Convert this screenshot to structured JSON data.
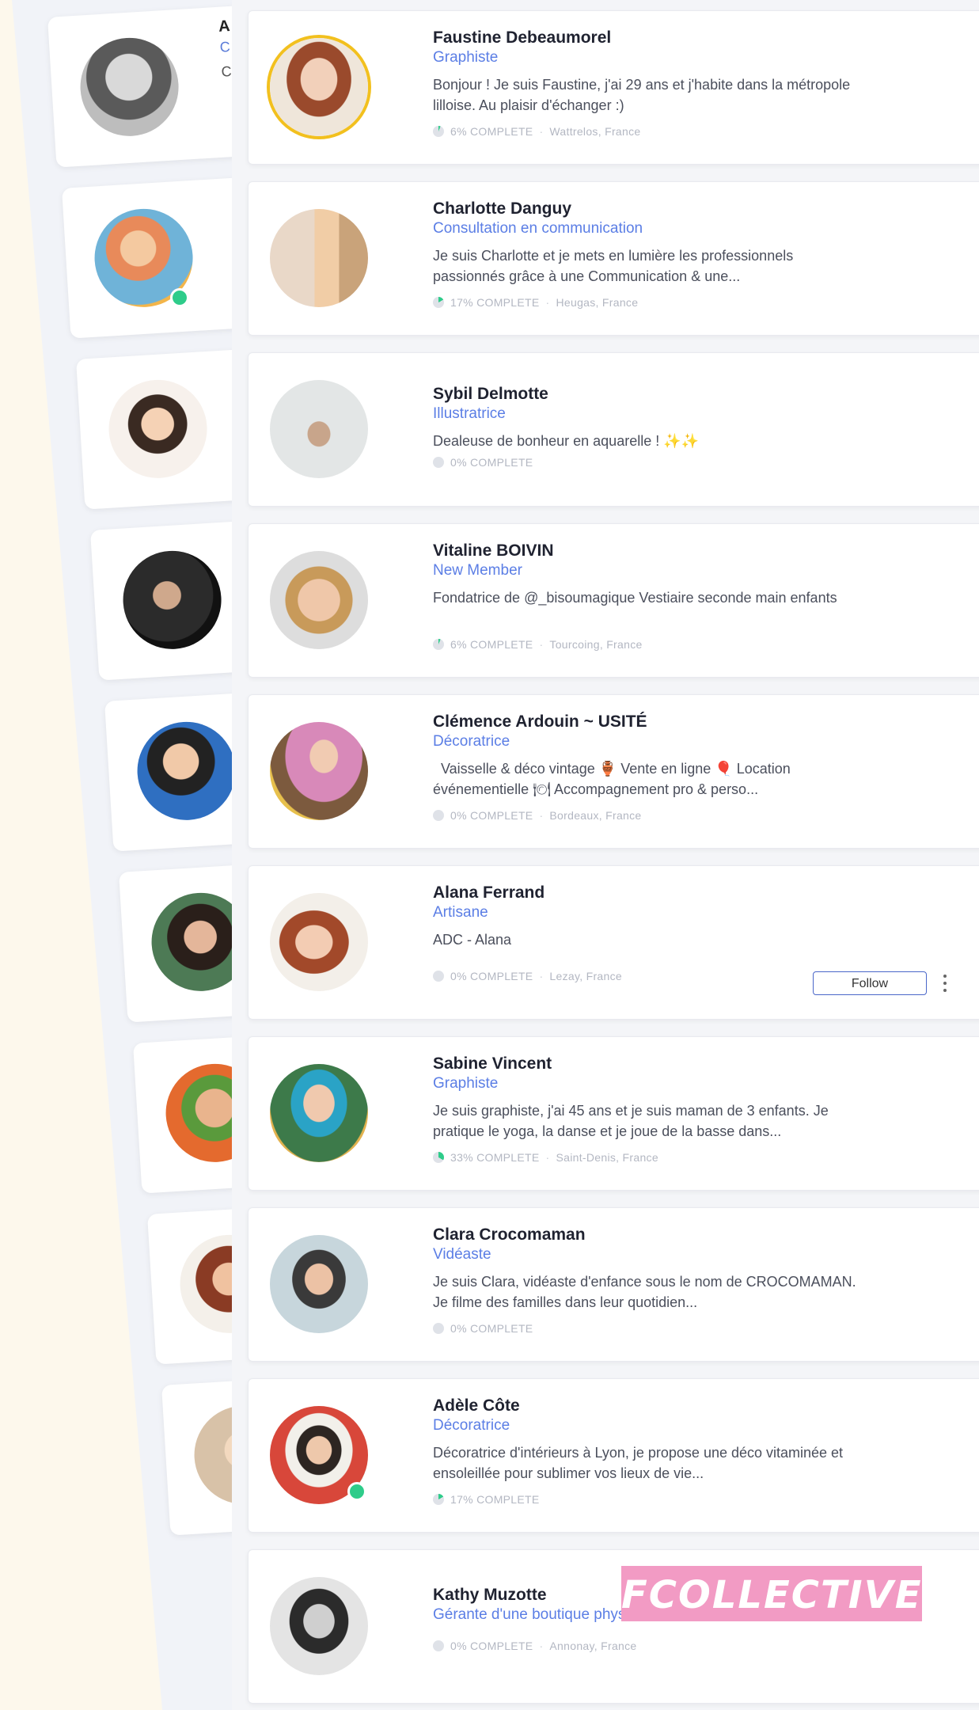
{
  "back_cards": [
    {
      "line1": "A",
      "line2": "C",
      "line3": "C  F"
    },
    {
      "line1": "",
      "line2": "",
      "line3": ""
    },
    {
      "line1": "",
      "line2": "",
      "line3": ""
    },
    {
      "line1": "",
      "line2": "",
      "line3": ""
    },
    {
      "line1": "",
      "line2": "",
      "line3": ""
    },
    {
      "line1": "",
      "line2": "",
      "line3": ""
    },
    {
      "line1": "",
      "line2": "",
      "line3": ""
    },
    {
      "line1": "",
      "line2": "",
      "line3": ""
    },
    {
      "line1": "",
      "line2": "",
      "line3": ""
    }
  ],
  "members": [
    {
      "name": "Faustine Debeaumorel",
      "role": "Graphiste",
      "bio": "Bonjour ! Je suis Faustine, j'ai 29 ans et j'habite dans la métropole lilloise. Au plaisir d'échanger :)",
      "completion": "6% COMPLETE",
      "completion_pct": 6,
      "location": "Wattrelos, France"
    },
    {
      "name": "Charlotte Danguy",
      "role": "Consultation en communication",
      "bio": "Je suis Charlotte et je mets en lumière les professionnels passionnés grâce à une Communication & une...",
      "completion": "17% COMPLETE",
      "completion_pct": 17,
      "location": "Heugas, France"
    },
    {
      "name": "Sybil Delmotte",
      "role": "Illustratrice",
      "bio": "Dealeuse de bonheur en aquarelle ! ✨✨",
      "completion": "0% COMPLETE",
      "completion_pct": 0,
      "location": ""
    },
    {
      "name": "Vitaline BOIVIN",
      "role": "New Member",
      "bio": "Fondatrice de @_bisoumagique Vestiaire seconde main enfants",
      "completion": "6% COMPLETE",
      "completion_pct": 6,
      "location": "Tourcoing, France"
    },
    {
      "name": "Clémence Ardouin ~ USITÉ",
      "role": "Décoratrice",
      "bio": "  Vaisselle & déco vintage 🏺 Vente en ligne 🎈 Location événementielle 🍽 Accompagnement pro & perso...",
      "completion": "0% COMPLETE",
      "completion_pct": 0,
      "location": "Bordeaux, France"
    },
    {
      "name": "Alana Ferrand",
      "role": "Artisane",
      "bio": "ADC - Alana",
      "completion": "0% COMPLETE",
      "completion_pct": 0,
      "location": "Lezay, France",
      "follow_label": "Follow"
    },
    {
      "name": "Sabine Vincent",
      "role": "Graphiste",
      "bio": "Je suis graphiste, j'ai 45 ans et je suis maman de 3 enfants. Je pratique le yoga, la danse et je joue de la basse dans...",
      "completion": "33% COMPLETE",
      "completion_pct": 33,
      "location": "Saint-Denis, France"
    },
    {
      "name": "Clara Crocomaman",
      "role": "Vidéaste",
      "bio": "Je suis Clara, vidéaste d'enfance sous le nom de CROCOMAMAN. Je filme des familles dans leur quotidien...",
      "completion": "0% COMPLETE",
      "completion_pct": 0,
      "location": ""
    },
    {
      "name": "Adèle Côte",
      "role": "Décoratrice",
      "bio": "Décoratrice d'intérieurs à Lyon, je propose une déco vitaminée et ensoleillée pour sublimer vos lieux de vie...",
      "completion": "17% COMPLETE",
      "completion_pct": 17,
      "location": ""
    },
    {
      "name": "Kathy Muzotte",
      "role": "Gérante d'une boutique physi",
      "bio": "",
      "completion": "0% COMPLETE",
      "completion_pct": 0,
      "location": "Annonay, France"
    }
  ],
  "logo_text": "FCOLLECTIVE",
  "colors": {
    "accent": "#5b7ee5",
    "online": "#2ecc8a",
    "progress": "#2ecc8a",
    "ring": "#f2c01e",
    "logo_bg": "#f29bc4"
  }
}
